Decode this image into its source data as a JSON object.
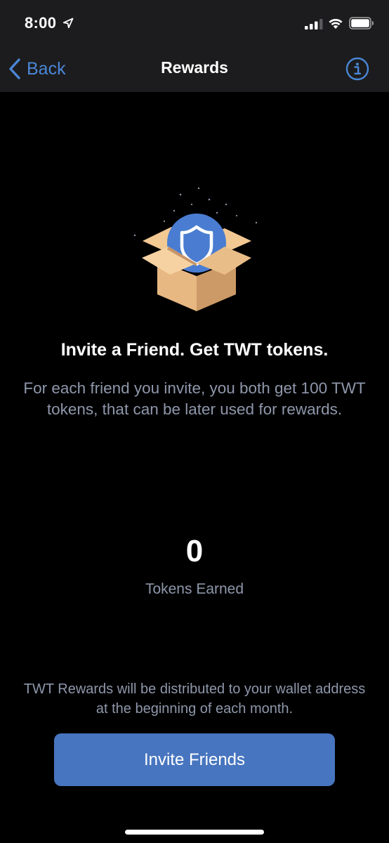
{
  "status_bar": {
    "time": "8:00",
    "icons": [
      "location-arrow-icon",
      "cellular-signal-icon",
      "wifi-icon",
      "battery-icon"
    ]
  },
  "nav": {
    "back_label": "Back",
    "title": "Rewards",
    "info_icon": "info-icon"
  },
  "hero": {
    "illustration": "gift-box-shield-icon",
    "headline": "Invite a Friend. Get TWT tokens.",
    "description": "For each friend you invite, you both get 100 TWT tokens, that can be later used for rewards."
  },
  "tokens": {
    "count": "0",
    "label": "Tokens Earned"
  },
  "footer": {
    "note": "TWT Rewards will be distributed to your wallet address at the beginning of each month.",
    "button_label": "Invite Friends"
  },
  "colors": {
    "background": "#000000",
    "nav_background": "#1c1c1e",
    "accent": "#4a86d6",
    "button": "#4775bf",
    "secondary_text": "#8e97ab"
  }
}
